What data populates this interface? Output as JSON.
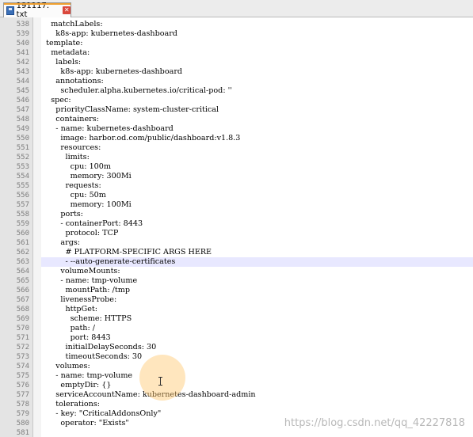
{
  "tab": {
    "filename": "191117. txt",
    "close_glyph": "✕"
  },
  "editor": {
    "lines": [
      {
        "n": "538",
        "text": "    matchLabels:"
      },
      {
        "n": "539",
        "text": "      k8s-app: kubernetes-dashboard"
      },
      {
        "n": "540",
        "text": "  template:"
      },
      {
        "n": "541",
        "text": "    metadata:"
      },
      {
        "n": "542",
        "text": "      labels:"
      },
      {
        "n": "543",
        "text": "        k8s-app: kubernetes-dashboard"
      },
      {
        "n": "544",
        "text": "      annotations:"
      },
      {
        "n": "545",
        "text": "        scheduler.alpha.kubernetes.io/critical-pod: ''"
      },
      {
        "n": "546",
        "text": "    spec:"
      },
      {
        "n": "547",
        "text": "      priorityClassName: system-cluster-critical"
      },
      {
        "n": "548",
        "text": "      containers:"
      },
      {
        "n": "549",
        "text": "      - name: kubernetes-dashboard"
      },
      {
        "n": "550",
        "text": "        image: harbor.od.com/public/dashboard:v1.8.3"
      },
      {
        "n": "551",
        "text": "        resources:"
      },
      {
        "n": "552",
        "text": "          limits:"
      },
      {
        "n": "553",
        "text": "            cpu: 100m"
      },
      {
        "n": "554",
        "text": "            memory: 300Mi"
      },
      {
        "n": "555",
        "text": "          requests:"
      },
      {
        "n": "556",
        "text": "            cpu: 50m"
      },
      {
        "n": "557",
        "text": "            memory: 100Mi"
      },
      {
        "n": "558",
        "text": "        ports:"
      },
      {
        "n": "559",
        "text": "        - containerPort: 8443"
      },
      {
        "n": "560",
        "text": "          protocol: TCP"
      },
      {
        "n": "561",
        "text": "        args:"
      },
      {
        "n": "562",
        "text": "          # PLATFORM-SPECIFIC ARGS HERE"
      },
      {
        "n": "563",
        "text": "          - --auto-generate-certificates"
      },
      {
        "n": "564",
        "text": "        volumeMounts:"
      },
      {
        "n": "565",
        "text": "        - name: tmp-volume"
      },
      {
        "n": "566",
        "text": "          mountPath: /tmp"
      },
      {
        "n": "567",
        "text": "        livenessProbe:"
      },
      {
        "n": "568",
        "text": "          httpGet:"
      },
      {
        "n": "569",
        "text": "            scheme: HTTPS"
      },
      {
        "n": "570",
        "text": "            path: /"
      },
      {
        "n": "571",
        "text": "            port: 8443"
      },
      {
        "n": "572",
        "text": "          initialDelaySeconds: 30"
      },
      {
        "n": "573",
        "text": "          timeoutSeconds: 30"
      },
      {
        "n": "574",
        "text": "      volumes:"
      },
      {
        "n": "575",
        "text": "      - name: tmp-volume"
      },
      {
        "n": "576",
        "text": "        emptyDir: {}"
      },
      {
        "n": "577",
        "text": "      serviceAccountName: kubernetes-dashboard-admin"
      },
      {
        "n": "578",
        "text": "      tolerations:"
      },
      {
        "n": "579",
        "text": "      - key: \"CriticalAddonsOnly\""
      },
      {
        "n": "580",
        "text": "        operator: \"Exists\""
      },
      {
        "n": "581",
        "text": ""
      }
    ],
    "current_line": "563"
  },
  "watermark": "https://blog.csdn.net/qq_42227818",
  "colors": {
    "highlight": "#e8e8ff",
    "tab_accent": "#f0a030"
  }
}
